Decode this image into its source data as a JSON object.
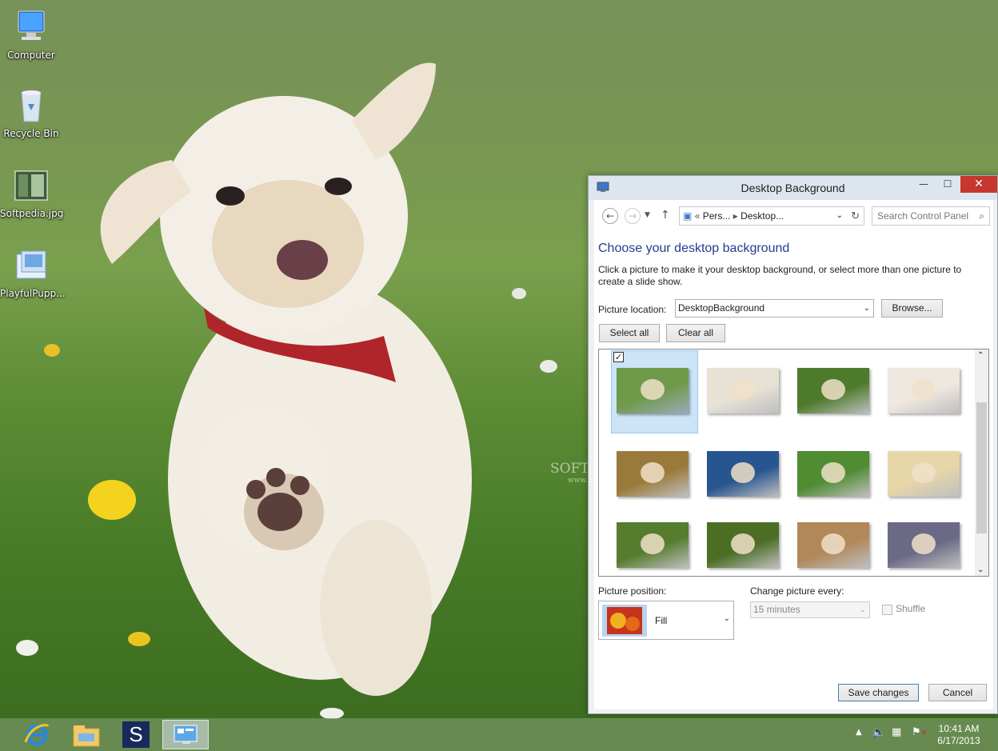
{
  "desktop": {
    "icons": [
      {
        "label": "Computer",
        "icon": "computer-icon"
      },
      {
        "label": "Recycle Bin",
        "icon": "recycle-bin-icon"
      },
      {
        "label": "Softpedia.jpg",
        "icon": "image-file-icon"
      },
      {
        "label": "PlayfulPupp...",
        "icon": "theme-pack-icon"
      }
    ]
  },
  "window": {
    "title": "Desktop Background",
    "controls": {
      "minimize": "—",
      "maximize": "☐",
      "close": "✕"
    },
    "address": {
      "part1": "Pers...",
      "part2": "Desktop..."
    },
    "search_placeholder": "Search Control Panel",
    "heading": "Choose your desktop background",
    "description": "Click a picture to make it your desktop background, or select more than one picture to create a slide show.",
    "picture_location_label": "Picture location:",
    "picture_location_value": "DesktopBackground",
    "browse_label": "Browse...",
    "select_all_label": "Select all",
    "clear_all_label": "Clear all",
    "thumbnails": [
      {
        "name": "puppy-running",
        "selected": true,
        "color": "#6f9a4a"
      },
      {
        "name": "puppy-jumping-white",
        "selected": false,
        "color": "#e8e2d6"
      },
      {
        "name": "black-puppy-grass",
        "selected": false,
        "color": "#4e7a2c"
      },
      {
        "name": "puppy-lying-white",
        "selected": false,
        "color": "#efe8e0"
      },
      {
        "name": "puppy-autumn-leaves",
        "selected": false,
        "color": "#9a7a3a"
      },
      {
        "name": "puppy-blue-bg",
        "selected": false,
        "color": "#27558f"
      },
      {
        "name": "collie-puppy-grass",
        "selected": false,
        "color": "#4f8c32"
      },
      {
        "name": "puppy-with-cake",
        "selected": false,
        "color": "#e7d6a8"
      },
      {
        "name": "puppies-in-grass",
        "selected": false,
        "color": "#567d2e"
      },
      {
        "name": "puppy-on-back",
        "selected": false,
        "color": "#4b6e24"
      },
      {
        "name": "puppy-running-field",
        "selected": false,
        "color": "#b0885a"
      },
      {
        "name": "puppies-bluebells",
        "selected": false,
        "color": "#6b6a86"
      }
    ],
    "picture_position_label": "Picture position:",
    "picture_position_value": "Fill",
    "change_every_label": "Change picture every:",
    "change_every_value": "15 minutes",
    "shuffle_label": "Shuffle",
    "save_label": "Save changes",
    "cancel_label": "Cancel"
  },
  "taskbar": {
    "apps": [
      "internet-explorer-icon",
      "file-explorer-icon",
      "softpedia-icon",
      "control-panel-icon"
    ],
    "softpedia_letter": "S",
    "time": "10:41 AM",
    "date": "6/17/2013"
  },
  "watermark": {
    "line1": "SOFTPEDIA",
    "line2": "www.softpedia.com"
  }
}
